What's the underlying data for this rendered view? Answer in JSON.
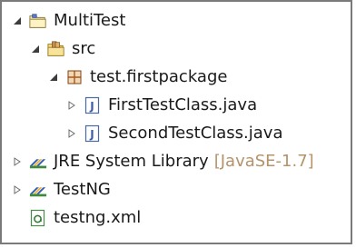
{
  "tree": {
    "project": {
      "label": "MultiTest"
    },
    "src": {
      "label": "src"
    },
    "package": {
      "label": "test.firstpackage"
    },
    "file1": {
      "label": "FirstTestClass.java"
    },
    "file2": {
      "label": "SecondTestClass.java"
    },
    "jre": {
      "label": "JRE System Library",
      "decoration": "[JavaSE-1.7]"
    },
    "testng": {
      "label": "TestNG"
    },
    "xml": {
      "label": "testng.xml"
    }
  },
  "icons": {
    "project": "project-folder-icon",
    "src": "source-folder-icon",
    "package": "package-icon",
    "java": "java-file-icon",
    "library": "library-icon",
    "xml": "xml-file-icon"
  }
}
